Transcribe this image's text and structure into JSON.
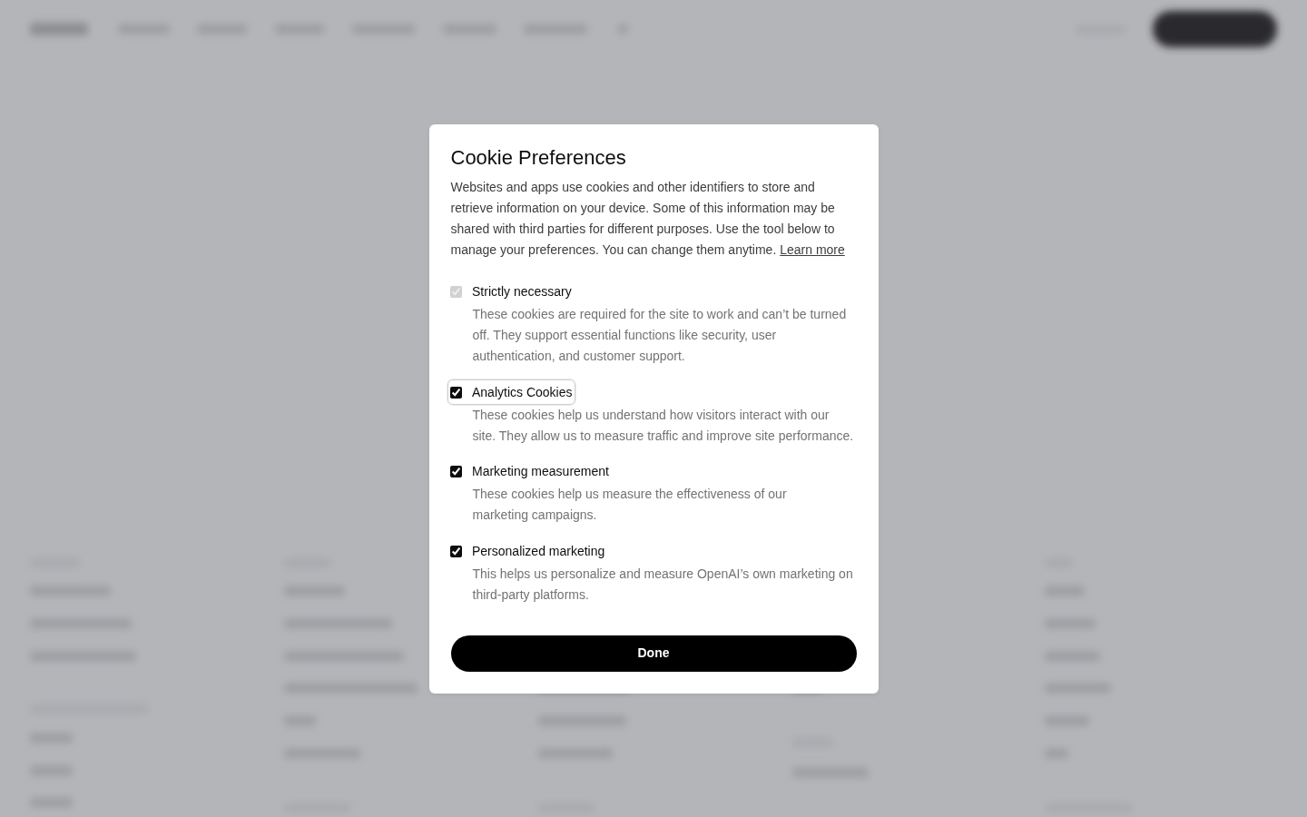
{
  "dialog": {
    "title": "Cookie Preferences",
    "intro": "Websites and apps use cookies and other identifiers to store and retrieve information on your device. Some of this information may be shared with third parties for different purposes. Use the tool below to manage your preferences. You can change them anytime.",
    "learn_more_link": "Learn more",
    "options": [
      {
        "label": "Strictly necessary",
        "description": "These cookies are required for the site to work and can’t be turned off. They support essential functions like security, user authentication, and customer support.",
        "checked": true,
        "disabled": true,
        "focused": false
      },
      {
        "label": "Analytics Cookies",
        "description": "These cookies help us understand how visitors interact with our site. They allow us to measure traffic and improve site performance.",
        "checked": true,
        "disabled": false,
        "focused": true
      },
      {
        "label": "Marketing measurement",
        "description": "These cookies help us measure the effectiveness of our marketing campaigns.",
        "checked": true,
        "disabled": false,
        "focused": false
      },
      {
        "label": "Personalized marketing",
        "description": "This helps us personalize and measure OpenAI’s own marketing on third-party platforms.",
        "checked": true,
        "disabled": false,
        "focused": false
      }
    ],
    "done_button": "Done"
  }
}
